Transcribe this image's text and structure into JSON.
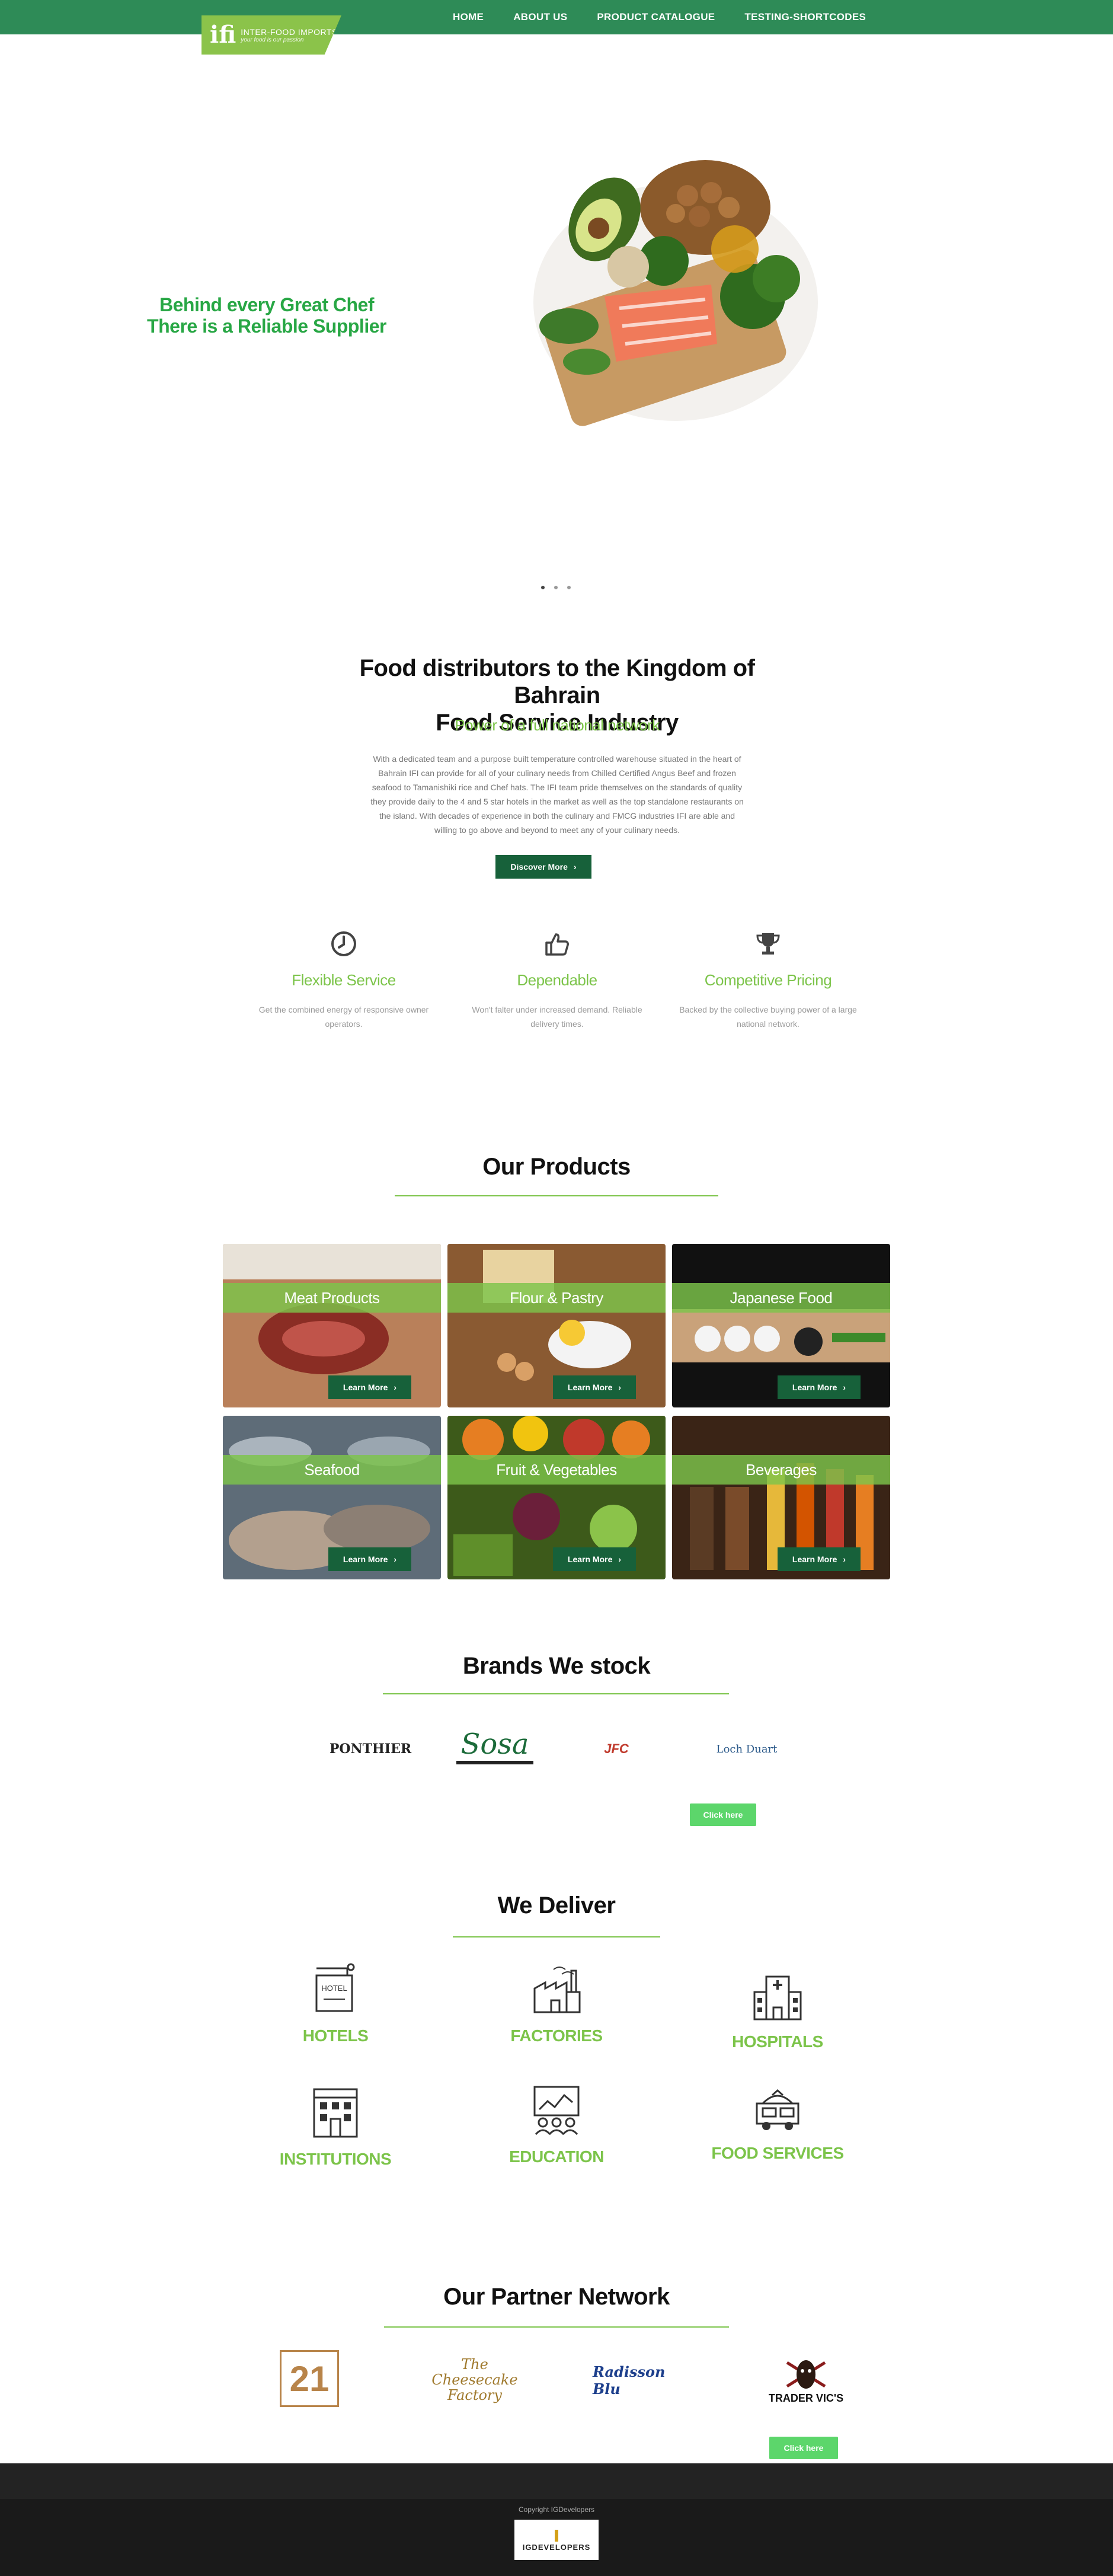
{
  "header": {
    "logo_text": "INTER-FOOD IMPORTS",
    "logo_tagline": "your food is our passion",
    "nav": [
      "HOME",
      "ABOUT US",
      "PRODUCT CATALOGUE",
      "TESTING-SHORTCODES"
    ]
  },
  "hero": {
    "line1": "Behind every Great Chef",
    "line2": "There is a Reliable Supplier"
  },
  "intro": {
    "title_line1": "Food distributors to the Kingdom of Bahrain",
    "title_line2": "Food Service Industry",
    "subtitle": "Power of a full national network",
    "body": "With a dedicated team and a purpose built temperature controlled warehouse situated in the heart of Bahrain IFI can provide for all of your culinary needs from Chilled Certified Angus Beef and frozen seafood to Tamanishiki rice and Chef hats. The IFI team pride themselves on the standards of quality they provide daily to the 4 and 5 star hotels in the market as well as the top standalone restaurants on the island. With decades of experience in both the culinary and FMCG industries IFI are able and willing to go above and beyond to meet any of your culinary needs.",
    "button": "Discover More"
  },
  "features": [
    {
      "title": "Flexible Service",
      "text": "Get the combined energy of responsive owner operators.",
      "icon": "clock-icon"
    },
    {
      "title": "Dependable",
      "text": "Won't falter under increased demand. Reliable delivery times.",
      "icon": "thumbs-up-icon"
    },
    {
      "title": "Competitive Pricing",
      "text": "Backed by the collective buying power of a large national network.",
      "icon": "trophy-icon"
    }
  ],
  "products": {
    "heading": "Our Products",
    "button": "Learn More",
    "items": [
      {
        "name": "Meat Products",
        "color": "#8a3b2e"
      },
      {
        "name": "Flour & Pastry",
        "color": "#9c7448"
      },
      {
        "name": "Japanese Food",
        "color": "#3a2a22"
      },
      {
        "name": "Seafood",
        "color": "#6d7a86"
      },
      {
        "name": "Fruit & Vegetables",
        "color": "#6b8a2a"
      },
      {
        "name": "Beverages",
        "color": "#4a2e1c"
      }
    ]
  },
  "brands": {
    "heading": "Brands We stock",
    "items": [
      "PONTHIER",
      "Sosa",
      "JFC",
      "Loch Duart"
    ],
    "button": "Click here"
  },
  "deliver": {
    "heading": "We Deliver",
    "items": [
      {
        "label": "HOTELS",
        "icon": "hotel-icon",
        "sign": "HOTEL"
      },
      {
        "label": "FACTORIES",
        "icon": "factory-icon"
      },
      {
        "label": "HOSPITALS",
        "icon": "hospital-icon"
      },
      {
        "label": "INSTITUTIONS",
        "icon": "institution-icon"
      },
      {
        "label": "EDUCATION",
        "icon": "education-icon"
      },
      {
        "label": "FOOD SERVICES",
        "icon": "food-truck-icon"
      }
    ]
  },
  "partners": {
    "heading": "Our Partner Network",
    "items": [
      "21",
      "The Cheesecake Factory",
      "Radisson Blu",
      "TRADER VIC'S"
    ],
    "button": "Click here"
  },
  "footer": {
    "copyright": "Copyright IGDevelopers",
    "logo_text": "IGDEVELOPERS"
  }
}
